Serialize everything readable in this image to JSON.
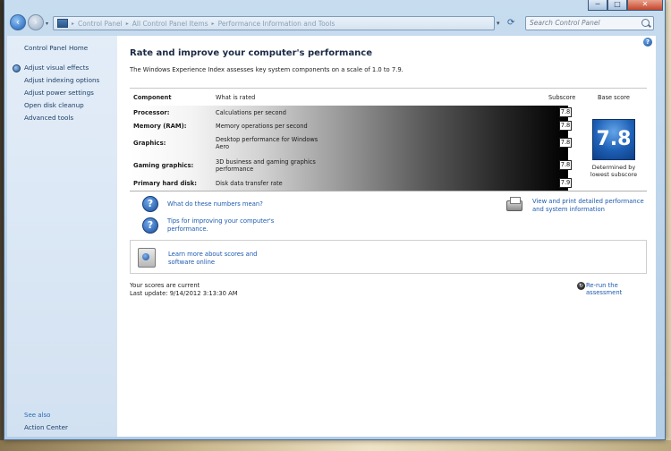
{
  "window": {
    "caption_buttons": {
      "minimize": "─",
      "maximize": "□",
      "close": "✕"
    }
  },
  "navbar": {
    "breadcrumbs": [
      "Control Panel",
      "All Control Panel Items",
      "Performance Information and Tools"
    ],
    "search_placeholder": "Search Control Panel"
  },
  "sidebar": {
    "home": "Control Panel Home",
    "tasks": [
      "Adjust visual effects",
      "Adjust indexing options",
      "Adjust power settings",
      "Open disk cleanup",
      "Advanced tools"
    ],
    "see_also": "See also",
    "action_center": "Action Center"
  },
  "main": {
    "heading": "Rate and improve your computer's performance",
    "intro": "The Windows Experience Index assesses key system components on a scale of 1.0 to 7.9.",
    "columns": {
      "component": "Component",
      "what_is_rated": "What is rated",
      "subscore": "Subscore",
      "base_score": "Base score"
    },
    "rows": [
      {
        "component": "Processor:",
        "rated": "Calculations per second",
        "subscore": "7.8"
      },
      {
        "component": "Memory (RAM):",
        "rated": "Memory operations per second",
        "subscore": "7.8"
      },
      {
        "component": "Graphics:",
        "rated": "Desktop performance for Windows Aero",
        "subscore": "7.8"
      },
      {
        "component": "Gaming graphics:",
        "rated": "3D business and gaming graphics performance",
        "subscore": "7.8"
      },
      {
        "component": "Primary hard disk:",
        "rated": "Disk data transfer rate",
        "subscore": "7.9"
      }
    ],
    "base_score": "7.8",
    "base_caption": "Determined by lowest subscore",
    "links": {
      "what_numbers": "What do these numbers mean?",
      "tips": "Tips for improving your computer's performance.",
      "print_details": "View and print detailed performance and system information",
      "learn_more": "Learn more about scores and software online"
    },
    "status": {
      "current": "Your scores are current",
      "last_update": "Last update: 9/14/2012 3:13:30 AM"
    },
    "rerun": "Re-run the assessment",
    "help": "?"
  }
}
